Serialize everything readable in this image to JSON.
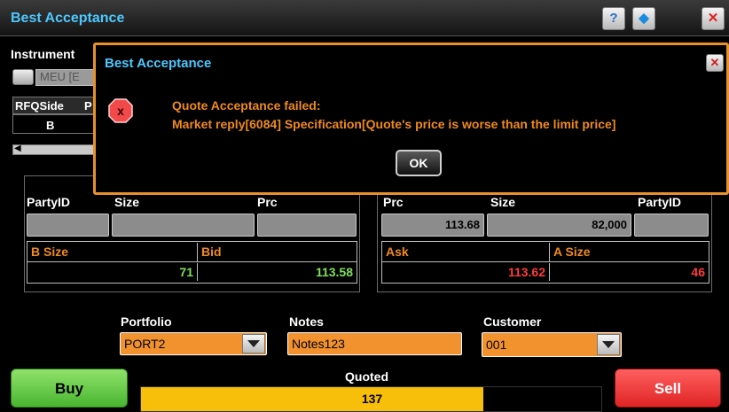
{
  "window": {
    "title": "Best Acceptance"
  },
  "background": {
    "instrument_label": "Instrument",
    "instrument_value": "MEU [E",
    "rfq_headers": [
      "RFQSide",
      "P"
    ],
    "rfq_row": [
      "B",
      ""
    ]
  },
  "dialog": {
    "title": "Best Acceptance",
    "line1": "Quote Acceptance failed:",
    "line2": "Market reply[6084] Specification[Quote's price is worse than the limit price]",
    "ok_label": "OK"
  },
  "bid_panel": {
    "partyid_label": "PartyID",
    "size_label": "Size",
    "prc_label": "Prc",
    "b_size_header": "B Size",
    "bid_header": "Bid",
    "b_size_value": "71",
    "bid_value": "113.58"
  },
  "ask_panel": {
    "prc_label": "Prc",
    "size_label": "Size",
    "partyid_label": "PartyID",
    "prc_value": "113.68",
    "size_value": "82,000",
    "ask_header": "Ask",
    "a_size_header": "A Size",
    "ask_value": "113.62",
    "a_size_value": "46"
  },
  "form": {
    "portfolio_label": "Portfolio",
    "portfolio_value": "PORT2",
    "notes_label": "Notes",
    "notes_value": "Notes123",
    "customer_label": "Customer",
    "customer_value": "001"
  },
  "actions": {
    "buy_label": "Buy",
    "sell_label": "Sell",
    "quoted_label": "Quoted",
    "quoted_value": "137",
    "quoted_fraction": 0.744
  },
  "colors": {
    "accent_orange": "#f08a1e",
    "bid_green": "#7fe05a",
    "ask_red": "#ff3a3a",
    "title_blue": "#4dc8ff",
    "quoted_bar": "#f7be0a"
  },
  "icons": [
    "help-icon",
    "settings-icon",
    "close-icon",
    "error-icon",
    "chevron-down-icon"
  ]
}
